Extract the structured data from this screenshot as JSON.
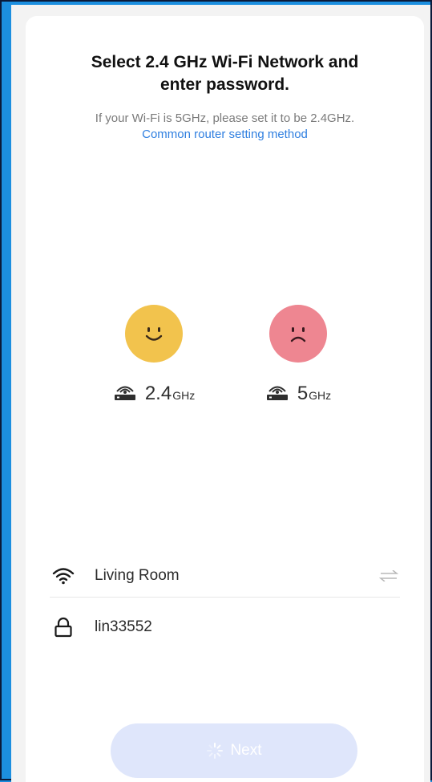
{
  "header": {
    "title": "Select 2.4 GHz Wi-Fi Network and\nenter password.",
    "subtitle": "If your Wi-Fi is 5GHz, please set it to be 2.4GHz.",
    "link": "Common router setting method"
  },
  "bands": [
    {
      "value": "2.4",
      "unit": "GHz",
      "face": "happy-face-icon",
      "color": "#f2c34d"
    },
    {
      "value": "5",
      "unit": "GHz",
      "face": "sad-face-icon",
      "color": "#ee8691"
    }
  ],
  "wifi": {
    "network": "Living Room",
    "icon": "wifi-icon",
    "switch_icon": "swap-arrows-icon"
  },
  "password": {
    "value": "lin33552",
    "icon": "lock-icon"
  },
  "next_button": {
    "label": "Next",
    "icon": "loading-spinner-icon",
    "color": "#dfe6fb"
  },
  "colors": {
    "accent": "#2f7fe0",
    "background": "#1c8fe0"
  }
}
